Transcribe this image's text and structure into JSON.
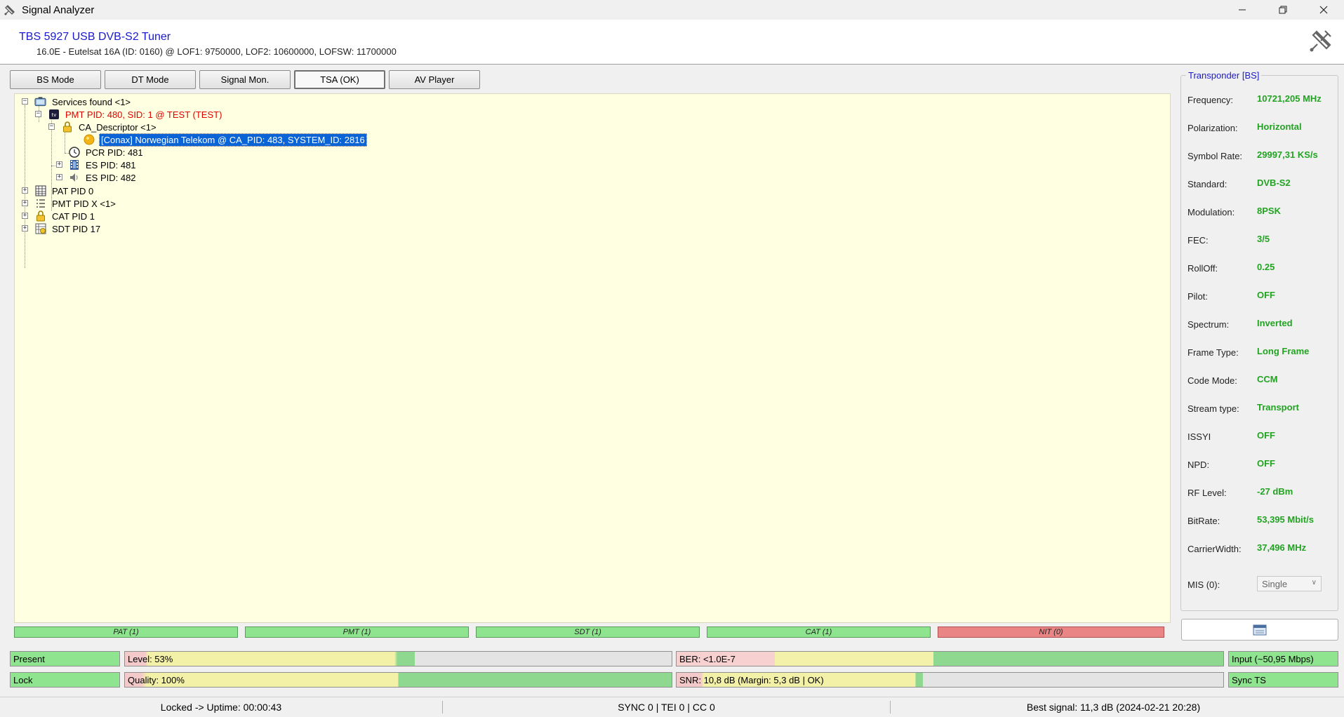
{
  "window": {
    "title": "Signal Analyzer"
  },
  "header": {
    "tuner_name": "TBS 5927 USB DVB-S2 Tuner",
    "sat_info": "16.0E - Eutelsat 16A (ID: 0160) @ LOF1: 9750000, LOF2: 10600000, LOFSW: 11700000"
  },
  "modes": [
    "BS Mode",
    "DT Mode",
    "Signal Mon.",
    "TSA (OK)",
    "AV Player"
  ],
  "tree": {
    "services": "Services found <1>",
    "pmt_service": "PMT PID: 480, SID: 1 @ TEST (TEST)",
    "ca_descriptor": "CA_Descriptor <1>",
    "conax": "[Conax] Norwegian Telekom @ CA_PID: 483, SYSTEM_ID: 2816",
    "pcr": "PCR PID: 481",
    "es1": "ES PID: 481",
    "es2": "ES PID: 482",
    "pat": "PAT PID 0",
    "pmtx": "PMT PID X <1>",
    "cat": "CAT PID 1",
    "sdt": "SDT PID 17"
  },
  "tables": [
    {
      "label": "PAT (1)",
      "state": "ok"
    },
    {
      "label": "PMT (1)",
      "state": "ok"
    },
    {
      "label": "SDT (1)",
      "state": "ok"
    },
    {
      "label": "CAT (1)",
      "state": "ok"
    },
    {
      "label": "NIT (0)",
      "state": "missing"
    }
  ],
  "transponder": {
    "title": "Transponder [BS]",
    "rows": [
      {
        "label": "Frequency:",
        "value": "10721,205 MHz"
      },
      {
        "label": "Polarization:",
        "value": "Horizontal"
      },
      {
        "label": "Symbol Rate:",
        "value": "29997,31 KS/s"
      },
      {
        "label": "Standard:",
        "value": "DVB-S2"
      },
      {
        "label": "Modulation:",
        "value": "8PSK"
      },
      {
        "label": "FEC:",
        "value": "3/5"
      },
      {
        "label": "RollOff:",
        "value": "0.25"
      },
      {
        "label": "Pilot:",
        "value": "OFF"
      },
      {
        "label": "Spectrum:",
        "value": "Inverted"
      },
      {
        "label": "Frame Type:",
        "value": "Long Frame"
      },
      {
        "label": "Code Mode:",
        "value": "CCM"
      },
      {
        "label": "Stream type:",
        "value": "Transport"
      },
      {
        "label": "ISSYI",
        "value": "OFF"
      },
      {
        "label": "NPD:",
        "value": "OFF"
      },
      {
        "label": "RF Level:",
        "value": "-27 dBm"
      },
      {
        "label": "BitRate:",
        "value": "53,395 Mbit/s"
      },
      {
        "label": "CarrierWidth:",
        "value": "37,496 MHz"
      }
    ],
    "mis_label": "MIS (0):",
    "mis_value": "Single"
  },
  "meters": {
    "present": "Present",
    "lock": "Lock",
    "level": "Level: 53%",
    "level_pct": 53,
    "quality": "Quality: 100%",
    "quality_pct": 100,
    "ber": "BER: <1.0E-7",
    "snr": "SNR: 10,8 dB (Margin: 5,3 dB | OK)",
    "input": "Input (~50,95 Mbps)",
    "sync": "Sync TS"
  },
  "status": {
    "left": "Locked -> Uptime: 00:00:43",
    "mid": "SYNC 0 | TEI 0 | CC 0",
    "right": "Best signal: 11,3 dB (2024-02-21 20:28)"
  },
  "colors": {
    "ok_green": "#8fe58f",
    "missing_red": "#e98585",
    "value_green": "#22a322",
    "title_blue": "#1a1acc",
    "tree_bg": "#ffffe1",
    "selection": "#0a64d6"
  }
}
